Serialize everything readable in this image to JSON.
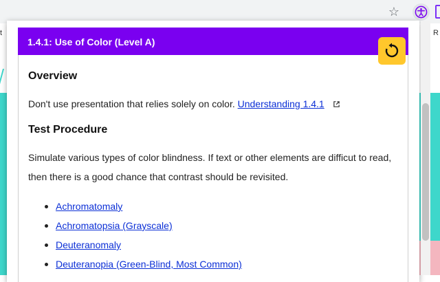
{
  "browser": {
    "bookmark_left": "t",
    "bookmark_right": "R"
  },
  "header": {
    "title": "1.4.1: Use of Color (Level A)"
  },
  "overview": {
    "heading": "Overview",
    "text": "Don't use presentation that relies solely on color.",
    "link": "Understanding 1.4.1"
  },
  "procedure": {
    "heading": "Test Procedure",
    "text": "Simulate various types of color blindness. If text or other elements are difficut to read, then there is a good chance that contrast should be revisited."
  },
  "methods": [
    "Achromatomaly",
    "Achromatopsia (Grayscale)",
    "Deuteranomaly",
    "Deuteranopia (Green-Blind, Most Common)"
  ],
  "colors": {
    "header_bg": "#7a00f0",
    "refresh_bg": "#ffc72c",
    "link": "#0b2fd6",
    "teal": "#3ed7cb"
  },
  "icons": {
    "star": "star-icon",
    "extension": "accessibility-icon",
    "refresh": "refresh-icon",
    "external": "external-link-icon"
  }
}
